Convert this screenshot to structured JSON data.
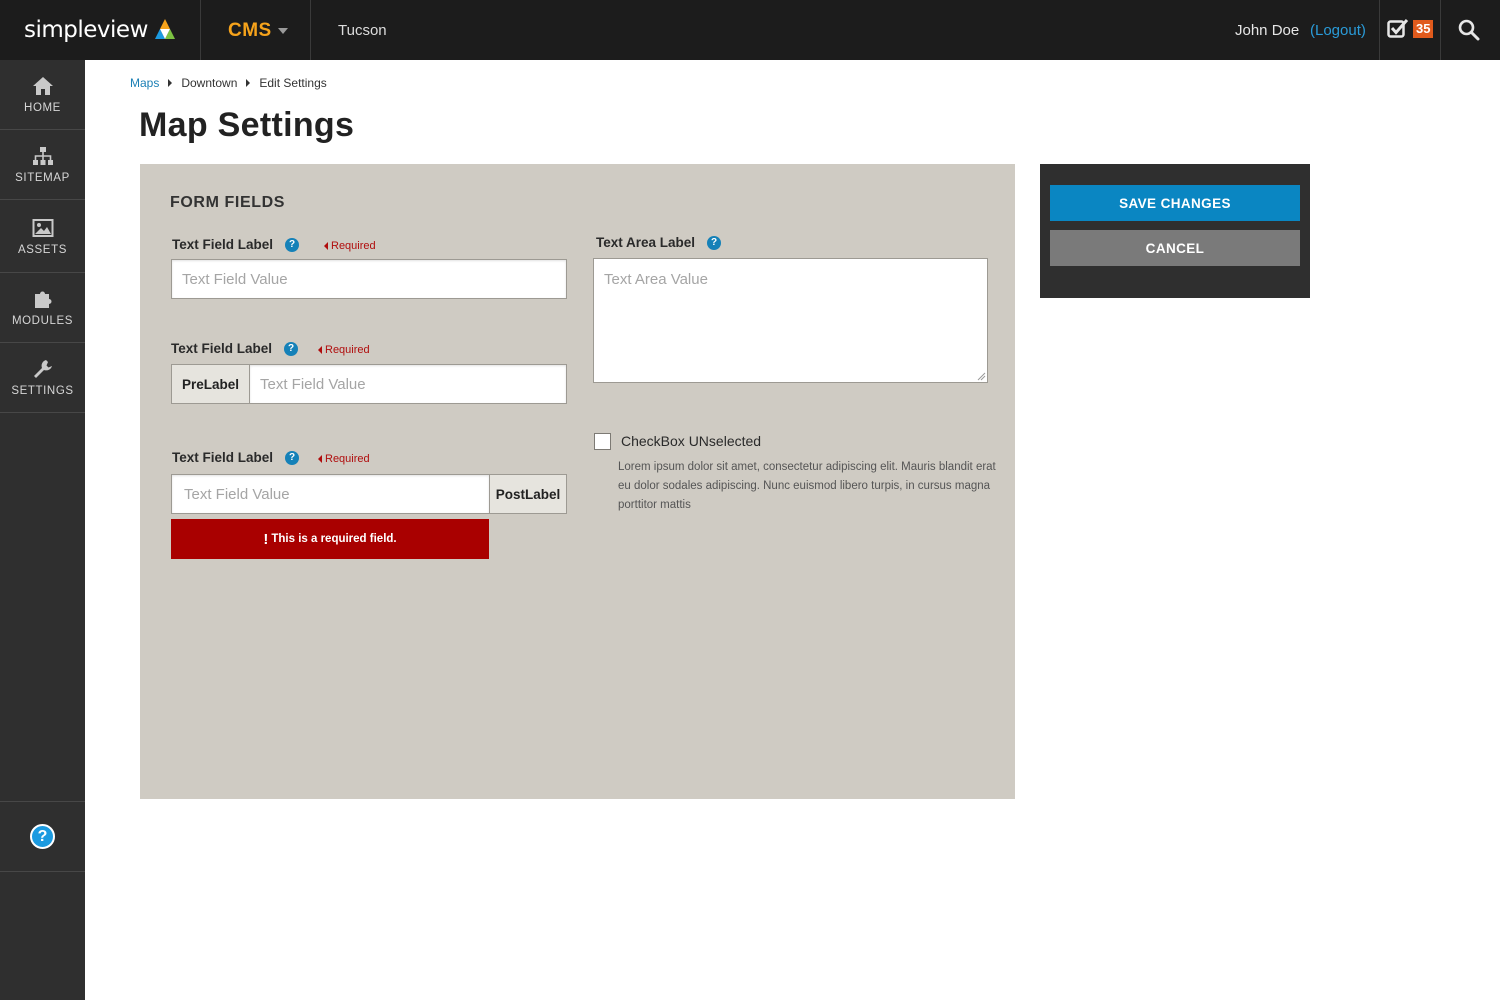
{
  "header": {
    "logo_text": "simpleview",
    "app_label": "CMS",
    "site_name": "Tucson",
    "user_name": "John Doe",
    "logout_label": "(Logout)",
    "task_count": "35"
  },
  "sidebar": {
    "items": [
      {
        "label": "HOME",
        "icon": "home-icon"
      },
      {
        "label": "SITEMAP",
        "icon": "sitemap-icon"
      },
      {
        "label": "ASSETS",
        "icon": "image-icon"
      },
      {
        "label": "MODULES",
        "icon": "puzzle-icon"
      },
      {
        "label": "SETTINGS",
        "icon": "wrench-icon"
      }
    ],
    "help_glyph": "?"
  },
  "breadcrumb": {
    "items": [
      "Maps",
      "Downtown",
      "Edit Settings"
    ]
  },
  "page": {
    "title": "Map Settings"
  },
  "form": {
    "section_title": "FORM FIELDS",
    "help_glyph": "?",
    "field1": {
      "label": "Text Field Label",
      "required": "Required",
      "placeholder": "Text Field Value"
    },
    "field2": {
      "label": "Text Field Label",
      "required": "Required",
      "prelabel": "PreLabel",
      "placeholder": "Text Field Value"
    },
    "field3": {
      "label": "Text Field Label",
      "required": "Required",
      "postlabel": "PostLabel",
      "placeholder": "Text Field Value",
      "error_mark": "!",
      "error": "This is a required field."
    },
    "textarea": {
      "label": "Text Area Label",
      "placeholder": "Text Area Value"
    },
    "checkbox": {
      "label": "CheckBox UNselected",
      "checked": false,
      "description": "Lorem ipsum dolor sit amet, consectetur adipiscing elit. Mauris blandit erat eu dolor sodales adipiscing. Nunc euismod libero turpis, in cursus magna porttitor mattis"
    }
  },
  "actions": {
    "save_label": "SAVE CHANGES",
    "cancel_label": "CANCEL"
  },
  "colors": {
    "topbar": "#1c1c1c",
    "sidebar": "#2f2f2f",
    "accent_orange": "#f6a31b",
    "link_blue": "#1a7fb5",
    "save_blue": "#0a86c2",
    "error_red": "#a90000",
    "panel_bg": "#cfcbc3"
  }
}
